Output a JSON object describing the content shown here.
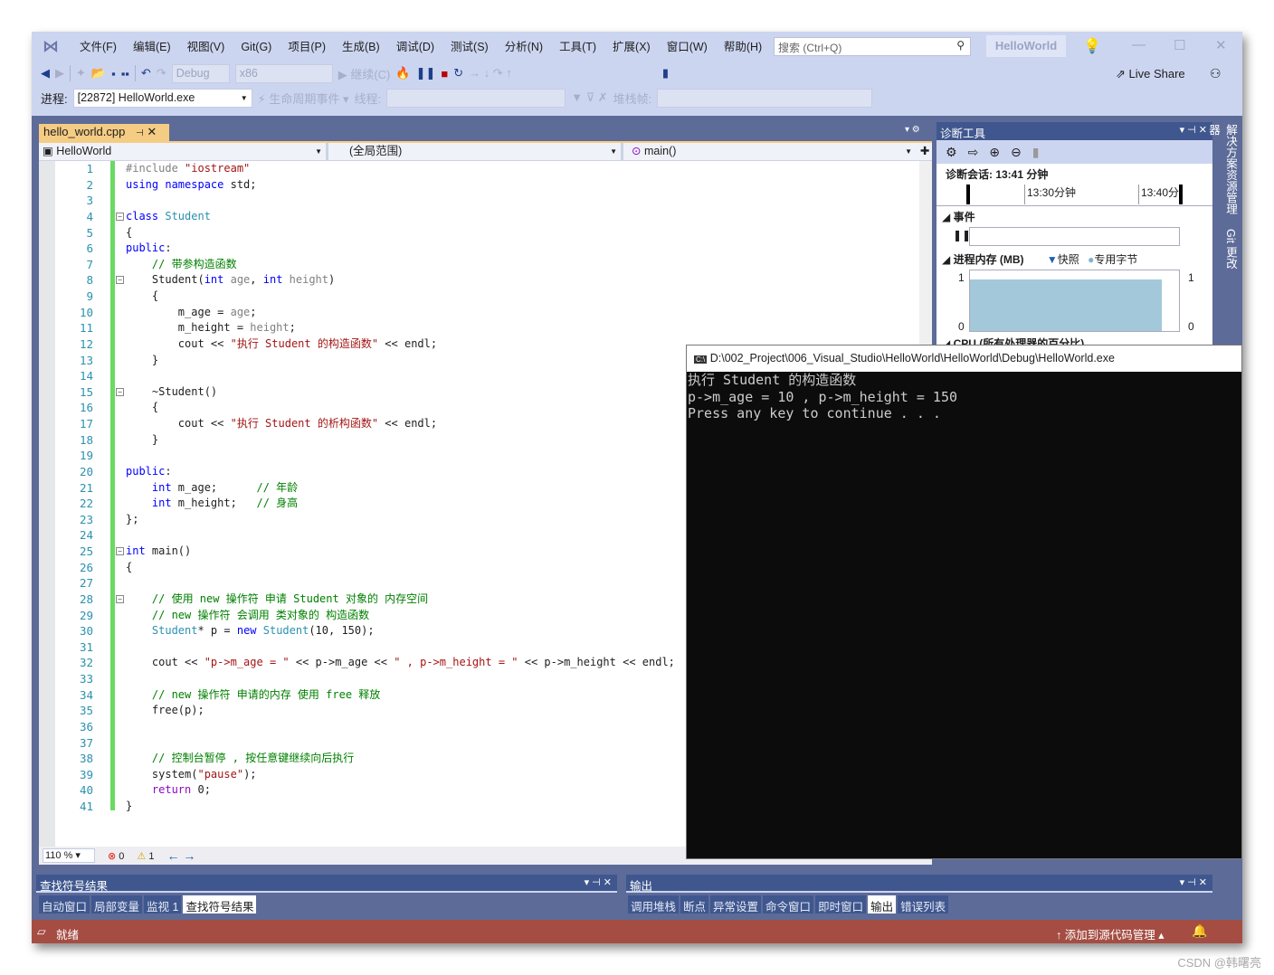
{
  "menu": [
    "文件(F)",
    "编辑(E)",
    "视图(V)",
    "Git(G)",
    "项目(P)",
    "生成(B)",
    "调试(D)",
    "测试(S)",
    "分析(N)",
    "工具(T)",
    "扩展(X)",
    "窗口(W)",
    "帮助(H)"
  ],
  "search_placeholder": "搜索 (Ctrl+Q)",
  "solution_name": "HelloWorld",
  "toolbar": {
    "config": "Debug",
    "platform": "x86",
    "continue": "继续(C)",
    "live_share": "Live Share"
  },
  "debugbar": {
    "process_label": "进程:",
    "process_value": "[22872] HelloWorld.exe",
    "lifecycle": "生命周期事件",
    "thread_label": "线程:",
    "stackframe_label": "堆栈帧:"
  },
  "editor": {
    "tab": "hello_world.cpp",
    "nav_project": "HelloWorld",
    "nav_scope": "(全局范围)",
    "nav_member": "main()",
    "zoom": "110 %",
    "errors": "0",
    "warnings": "1",
    "lines": [
      [
        [
          "#include ",
          "pp"
        ],
        [
          "\"iostream\"",
          "st"
        ]
      ],
      [
        [
          "using namespace ",
          "kw"
        ],
        [
          "std;",
          "tx"
        ]
      ],
      [],
      [
        [
          "class ",
          "kw"
        ],
        [
          "Student",
          "ty"
        ]
      ],
      [
        [
          "{",
          "tx"
        ]
      ],
      [
        [
          "public",
          "kw"
        ],
        [
          ":",
          "tx"
        ]
      ],
      [
        [
          "    // 带参构造函数",
          "cm"
        ]
      ],
      [
        [
          "    Student(",
          "tx"
        ],
        [
          "int ",
          "kw"
        ],
        [
          "age",
          "pa"
        ],
        [
          ", ",
          "tx"
        ],
        [
          "int ",
          "kw"
        ],
        [
          "height",
          "pa"
        ],
        [
          ")",
          "tx"
        ]
      ],
      [
        [
          "    {",
          "tx"
        ]
      ],
      [
        [
          "        m_age = ",
          "tx"
        ],
        [
          "age",
          "pa"
        ],
        [
          ";",
          "tx"
        ]
      ],
      [
        [
          "        m_height = ",
          "tx"
        ],
        [
          "height",
          "pa"
        ],
        [
          ";",
          "tx"
        ]
      ],
      [
        [
          "        cout << ",
          "tx"
        ],
        [
          "\"执行 Student 的构造函数\"",
          "st"
        ],
        [
          " << endl;",
          "tx"
        ]
      ],
      [
        [
          "    }",
          "tx"
        ]
      ],
      [],
      [
        [
          "    ~Student()",
          "tx"
        ]
      ],
      [
        [
          "    {",
          "tx"
        ]
      ],
      [
        [
          "        cout << ",
          "tx"
        ],
        [
          "\"执行 Student 的析构函数\"",
          "st"
        ],
        [
          " << endl;",
          "tx"
        ]
      ],
      [
        [
          "    }",
          "tx"
        ]
      ],
      [],
      [
        [
          "public",
          "kw"
        ],
        [
          ":",
          "tx"
        ]
      ],
      [
        [
          "    int ",
          "kw"
        ],
        [
          "m_age;      ",
          "tx"
        ],
        [
          "// 年龄",
          "cm"
        ]
      ],
      [
        [
          "    int ",
          "kw"
        ],
        [
          "m_height;   ",
          "tx"
        ],
        [
          "// 身高",
          "cm"
        ]
      ],
      [
        [
          "};",
          "tx"
        ]
      ],
      [],
      [
        [
          "int ",
          "kw"
        ],
        [
          "main()",
          "tx"
        ]
      ],
      [
        [
          "{",
          "tx"
        ]
      ],
      [],
      [
        [
          "    // 使用 new 操作符 申请 Student 对象的 内存空间",
          "cm"
        ]
      ],
      [
        [
          "    // new 操作符 会调用 类对象的 构造函数",
          "cm"
        ]
      ],
      [
        [
          "    Student",
          "ty"
        ],
        [
          "* p = ",
          "tx"
        ],
        [
          "new ",
          "kw"
        ],
        [
          "Student",
          "ty"
        ],
        [
          "(10, 150);",
          "tx"
        ]
      ],
      [],
      [
        [
          "    cout << ",
          "tx"
        ],
        [
          "\"p->m_age = \"",
          "st"
        ],
        [
          " << p->m_age << ",
          "tx"
        ],
        [
          "\" , p->m_height = \"",
          "st"
        ],
        [
          " << p->m_height << endl;",
          "tx"
        ]
      ],
      [],
      [
        [
          "    // new 操作符 申请的内存 使用 free 释放",
          "cm"
        ]
      ],
      [
        [
          "    free(p);",
          "tx"
        ]
      ],
      [],
      [],
      [
        [
          "    // 控制台暂停 , 按任意键继续向后执行",
          "cm"
        ]
      ],
      [
        [
          "    system(",
          "tx"
        ],
        [
          "\"pause\"",
          "st"
        ],
        [
          ");",
          "tx"
        ]
      ],
      [
        [
          "    return ",
          "pu"
        ],
        [
          "0;",
          "tx"
        ]
      ],
      [
        [
          "}",
          "tx"
        ]
      ]
    ],
    "fold_lines": [
      4,
      8,
      15,
      25,
      28
    ]
  },
  "diagnostics": {
    "title": "诊断工具",
    "session": "诊断会话: 13:41 分钟",
    "tick1": "13:30分钟",
    "tick2": "13:40分",
    "events": "事件",
    "memory": "进程内存 (MB)",
    "snapshot": "快照",
    "private_bytes": "专用字节",
    "y_max": "1",
    "y_min": "0",
    "cpu": "CPU (所有处理器的百分比)",
    "memory_level": 0.85
  },
  "side_tabs": [
    "解决方案资源管理器",
    "Git 更改"
  ],
  "console": {
    "title": "D:\\002_Project\\006_Visual_Studio\\HelloWorld\\HelloWorld\\Debug\\HelloWorld.exe",
    "output": [
      "执行 Student 的构造函数",
      "p->m_age = 10 , p->m_height = 150",
      "Press any key to continue . . ."
    ]
  },
  "left_panel": {
    "title": "查找符号结果",
    "tabs": [
      "自动窗口",
      "局部变量",
      "监视 1",
      "查找符号结果"
    ],
    "active": 3
  },
  "right_panel": {
    "title": "输出",
    "tabs": [
      "调用堆栈",
      "断点",
      "异常设置",
      "命令窗口",
      "即时窗口",
      "输出",
      "错误列表"
    ],
    "active": 5
  },
  "status": {
    "ready": "就绪",
    "source_control": "添加到源代码管理"
  },
  "watermark": "CSDN @韩曙亮"
}
